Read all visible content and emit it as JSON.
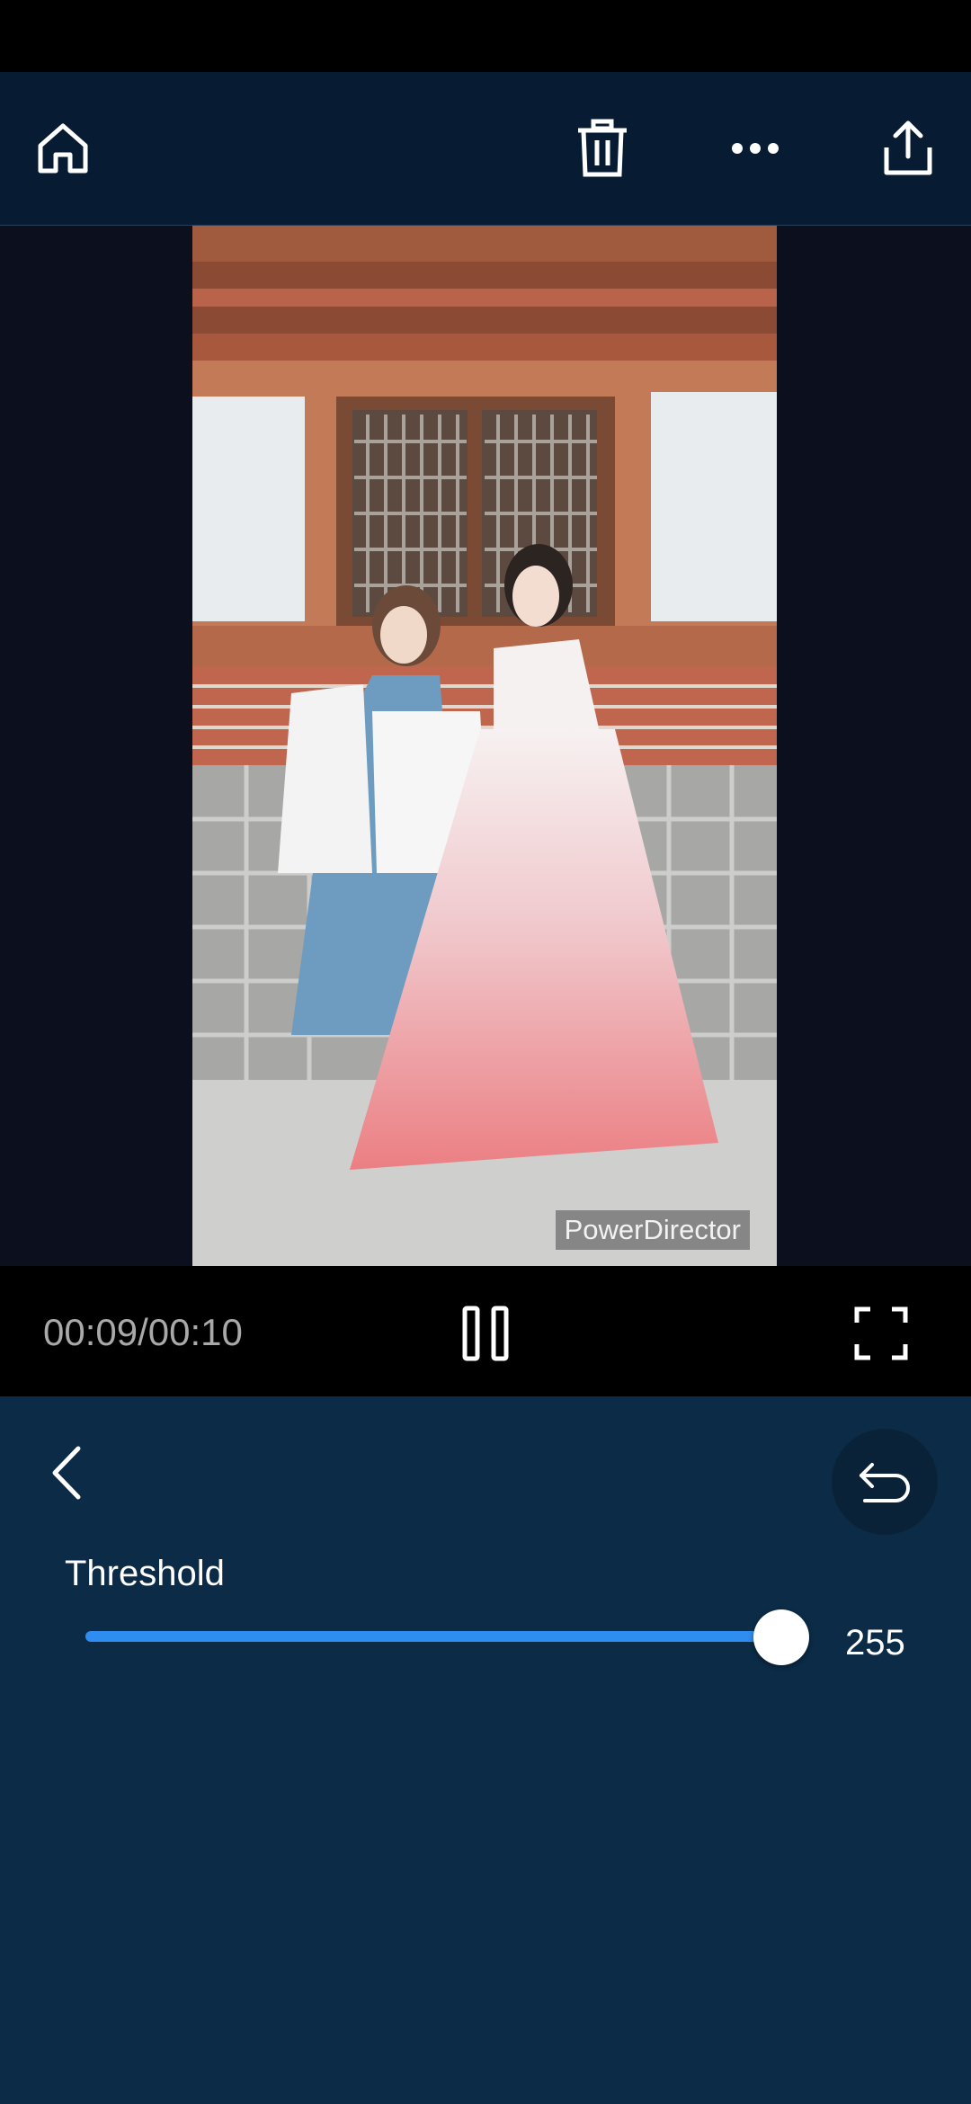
{
  "toolbar": {
    "home_icon": "home-icon",
    "delete_icon": "trash-icon",
    "more_icon": "more-horizontal-icon",
    "share_icon": "share-upload-icon"
  },
  "preview": {
    "watermark": "PowerDirector"
  },
  "player": {
    "time": "00:09/00:10",
    "play_state": "playing",
    "pause_icon": "pause-icon",
    "fullscreen_icon": "fullscreen-icon"
  },
  "panel": {
    "back_icon": "chevron-left-icon",
    "undo_icon": "undo-icon",
    "threshold": {
      "label": "Threshold",
      "value": "255",
      "min": 0,
      "max": 255,
      "fraction": 0.98
    }
  },
  "colors": {
    "status_bar": "#000000",
    "top_bar": "#071c33",
    "preview_bg": "#0b0f1e",
    "panel_bg": "#0b2b47",
    "accent": "#2f8cf0"
  }
}
